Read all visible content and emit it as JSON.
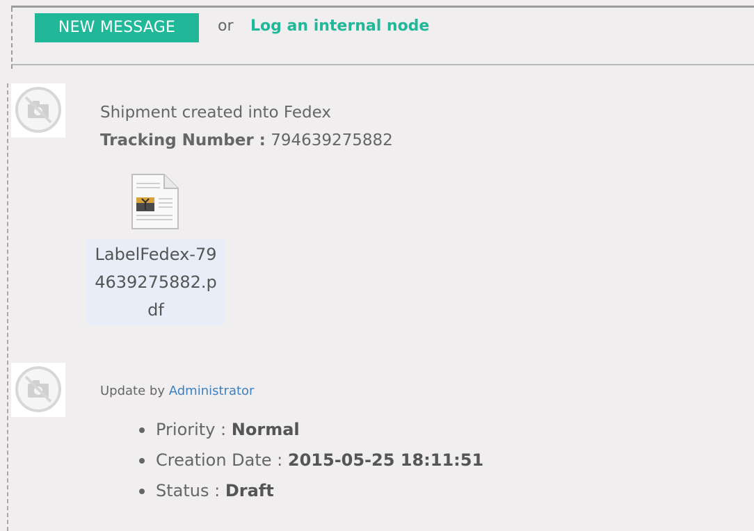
{
  "composer": {
    "new_message_label": "NEW MESSAGE",
    "or_text": "or",
    "log_internal_label": "Log an internal node"
  },
  "thread": [
    {
      "type": "message",
      "avatar_icon": "no-photo-icon",
      "title": "Shipment created into Fedex",
      "tracking_label": "Tracking Number :",
      "tracking_value": "794639275882",
      "attachment": {
        "icon": "pdf-document-icon",
        "filename": "LabelFedex-794639275882.pdf"
      }
    },
    {
      "type": "update",
      "avatar_icon": "no-photo-icon",
      "update_prefix": "Update by",
      "author": "Administrator",
      "details": [
        {
          "label": "Priority :",
          "value": "Normal"
        },
        {
          "label": "Creation Date :",
          "value": "2015-05-25 18:11:51"
        },
        {
          "label": "Status :",
          "value": "Draft"
        }
      ]
    }
  ],
  "colors": {
    "accent": "#21b799",
    "link": "#3f7fbf",
    "background": "#f0eeee"
  }
}
